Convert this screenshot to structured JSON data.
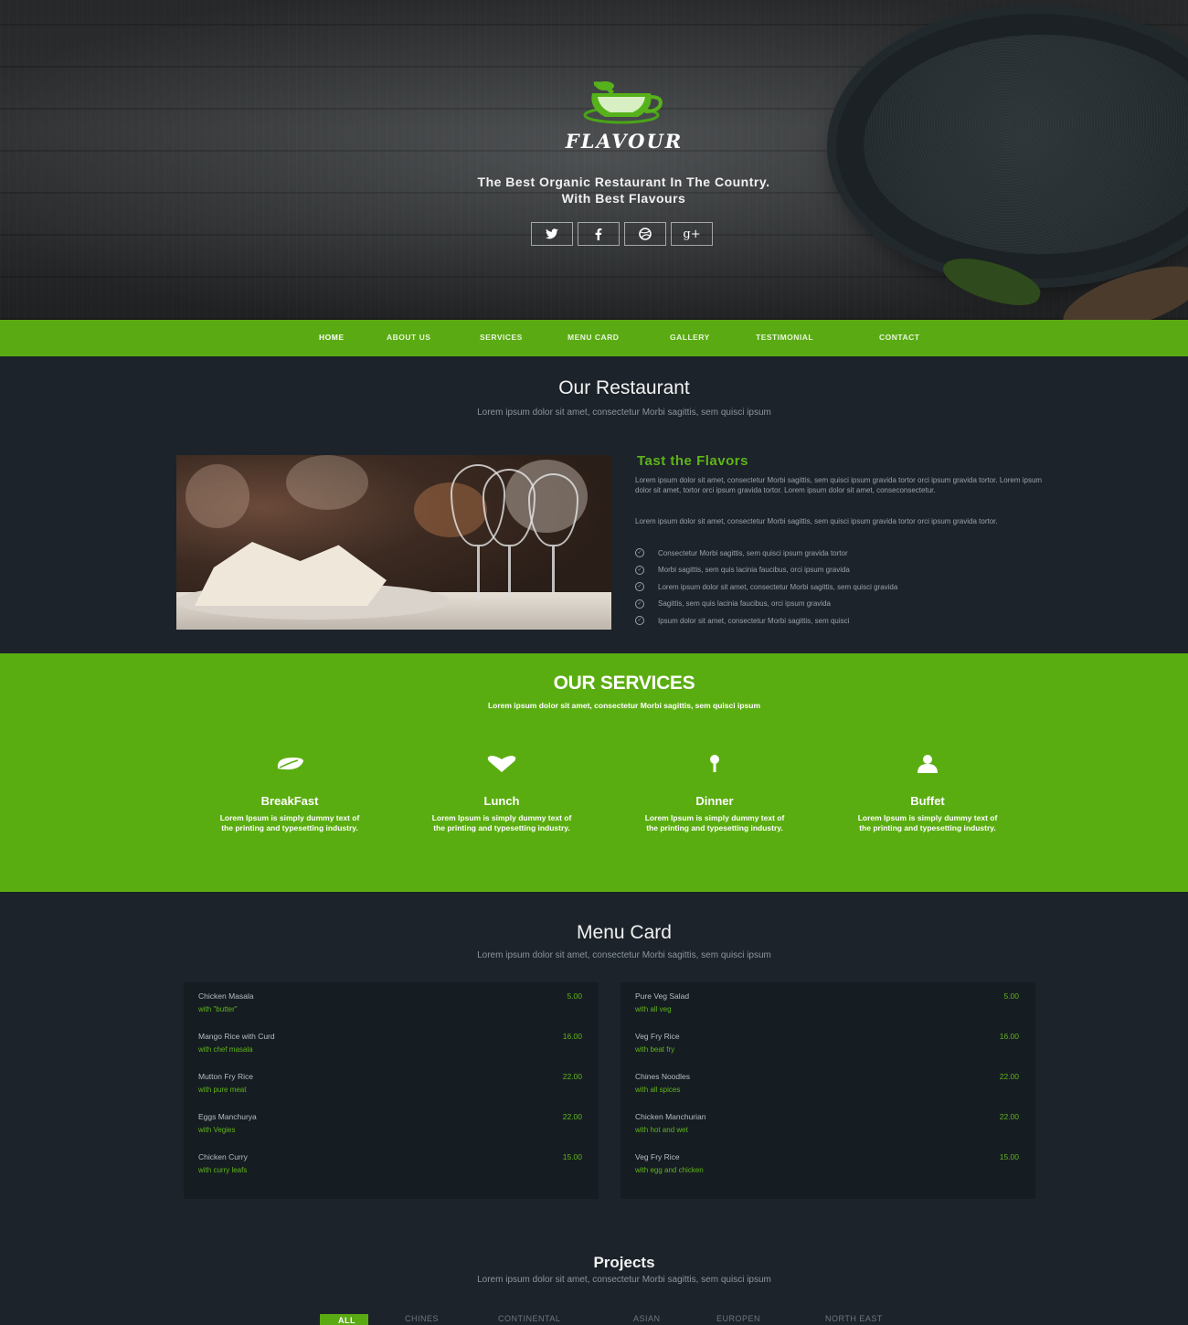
{
  "hero": {
    "brand": "FLAVOUR",
    "tagline_line1": "The Best Organic Restaurant In The Country.",
    "tagline_line2": "With Best Flavours",
    "social": [
      {
        "icon": "twitter-icon",
        "glyph": "🐦"
      },
      {
        "icon": "facebook-icon",
        "glyph": "f"
      },
      {
        "icon": "dribbble-icon",
        "glyph": "◍"
      },
      {
        "icon": "google-plus-icon",
        "glyph": "g+"
      }
    ]
  },
  "nav": {
    "items": [
      "HOME",
      "ABOUT US",
      "SERVICES",
      "MENU CARD",
      "GALLERY",
      "TESTIMONIAL",
      "CONTACT"
    ],
    "active": "HOME"
  },
  "restaurant": {
    "title": "Our Restaurant",
    "subtitle": "Lorem ipsum dolor sit amet, consectetur Morbi sagittis, sem quisci ipsum",
    "heading": "Tast the Flavors",
    "para1": "Lorem ipsum dolor sit amet, consectetur Morbi sagittis, sem quisci ipsum gravida tortor orci ipsum gravida tortor. Lorem ipsum dolor sit amet, tortor orci ipsum gravida tortor. Lorem ipsum dolor sit amet, conseconsectetur.",
    "para2": "Lorem ipsum dolor sit amet, consectetur Morbi sagittis, sem quisci ipsum gravida tortor orci ipsum gravida tortor.",
    "checks": [
      "Consectetur Morbi sagittis, sem quisci ipsum gravida tortor",
      "Morbi sagittis, sem quis lacinia faucibus, orci ipsum gravida",
      "Lorem ipsum dolor sit amet, consectetur Morbi sagittis, sem quisci gravida",
      "Sagittis, sem quis lacinia faucibus, orci ipsum gravida",
      "Ipsum dolor sit amet, consectetur Morbi sagittis, sem quisci"
    ]
  },
  "services": {
    "title": "OUR SERVICES",
    "subtitle": "Lorem ipsum dolor sit amet, consectetur Morbi sagittis, sem quisci ipsum",
    "items": [
      {
        "name": "BreakFast",
        "icon": "leaf-icon",
        "desc": "Lorem Ipsum is simply dummy text of the printing and typesetting industry."
      },
      {
        "name": "Lunch",
        "icon": "heart-icon",
        "desc": "Lorem Ipsum is simply dummy text of the printing and typesetting industry."
      },
      {
        "name": "Dinner",
        "icon": "pin-icon",
        "desc": "Lorem Ipsum is simply dummy text of the printing and typesetting industry."
      },
      {
        "name": "Buffet",
        "icon": "user-icon",
        "desc": "Lorem Ipsum is simply dummy text of the printing and typesetting industry."
      }
    ]
  },
  "menu": {
    "title": "Menu Card",
    "subtitle": "Lorem ipsum dolor sit amet, consectetur Morbi sagittis, sem quisci ipsum",
    "left": [
      {
        "name": "Chicken Masala",
        "price": "5.00",
        "sub": "with \"butter\""
      },
      {
        "name": "Mango Rice with Curd",
        "price": "16.00",
        "sub": "with chef masala"
      },
      {
        "name": "Mutton Fry Rice",
        "price": "22.00",
        "sub": "with pure meat"
      },
      {
        "name": "Eggs Manchurya",
        "price": "22.00",
        "sub": "with Vegies"
      },
      {
        "name": "Chicken Curry",
        "price": "15.00",
        "sub": "with curry leafs"
      }
    ],
    "right": [
      {
        "name": "Pure Veg Salad",
        "price": "5.00",
        "sub": "with all veg"
      },
      {
        "name": "Veg Fry Rice",
        "price": "16.00",
        "sub": "with beat fry"
      },
      {
        "name": "Chines Noodles",
        "price": "22.00",
        "sub": "with all spices"
      },
      {
        "name": "Chicken Manchurian",
        "price": "22.00",
        "sub": "with hot and wet"
      },
      {
        "name": "Veg Fry Rice",
        "price": "15.00",
        "sub": "with egg and chicken"
      }
    ]
  },
  "projects": {
    "title": "Projects",
    "subtitle": "Lorem ipsum dolor sit amet, consectetur Morbi sagittis, sem quisci ipsum",
    "filters": [
      "ALL",
      "CHINES",
      "CONTINENTAL",
      "ASIAN",
      "EUROPEN",
      "NORTH EAST"
    ],
    "active": "ALL"
  },
  "colors": {
    "accent": "#5aab13",
    "background": "#1c232a",
    "panel": "#161d22"
  }
}
